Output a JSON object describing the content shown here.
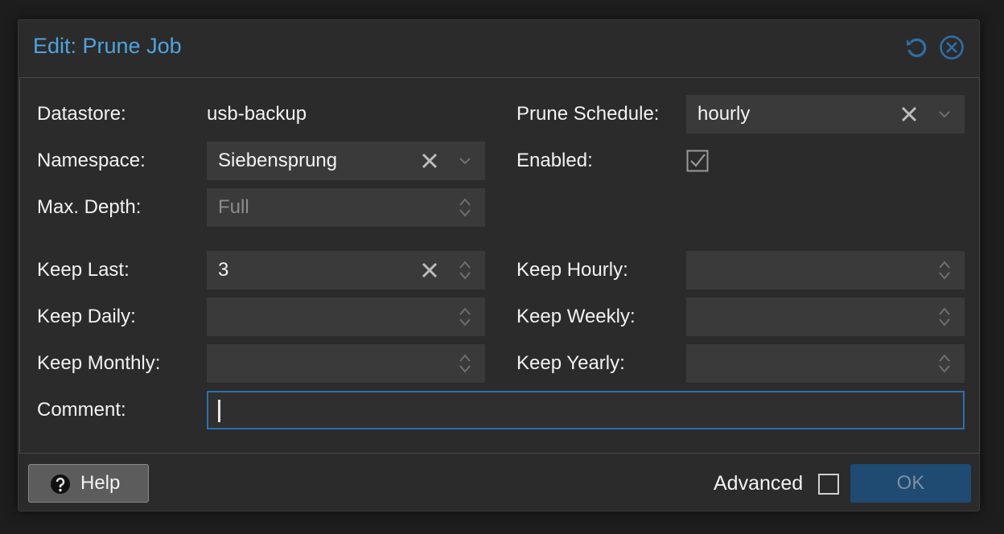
{
  "dialog": {
    "title": "Edit: Prune Job",
    "tools": {
      "reset_icon": "reset-icon",
      "close_icon": "close-circle-icon"
    }
  },
  "form": {
    "datastore": {
      "label": "Datastore:",
      "value": "usb-backup"
    },
    "prune_schedule": {
      "label": "Prune Schedule:",
      "value": "hourly"
    },
    "namespace": {
      "label": "Namespace:",
      "value": "Siebensprung"
    },
    "enabled": {
      "label": "Enabled:",
      "checked": true
    },
    "max_depth": {
      "label": "Max. Depth:",
      "value": "Full"
    },
    "keep_last": {
      "label": "Keep Last:",
      "value": "3"
    },
    "keep_hourly": {
      "label": "Keep Hourly:",
      "value": ""
    },
    "keep_daily": {
      "label": "Keep Daily:",
      "value": ""
    },
    "keep_weekly": {
      "label": "Keep Weekly:",
      "value": ""
    },
    "keep_monthly": {
      "label": "Keep Monthly:",
      "value": ""
    },
    "keep_yearly": {
      "label": "Keep Yearly:",
      "value": ""
    },
    "comment": {
      "label": "Comment:",
      "value": ""
    }
  },
  "footer": {
    "help_label": "Help",
    "advanced_label": "Advanced",
    "advanced_checked": false,
    "ok_label": "OK"
  },
  "colors": {
    "accent": "#4fa3e0",
    "ok_button": "#1f4a72",
    "focus_border": "#2b6fb0"
  }
}
